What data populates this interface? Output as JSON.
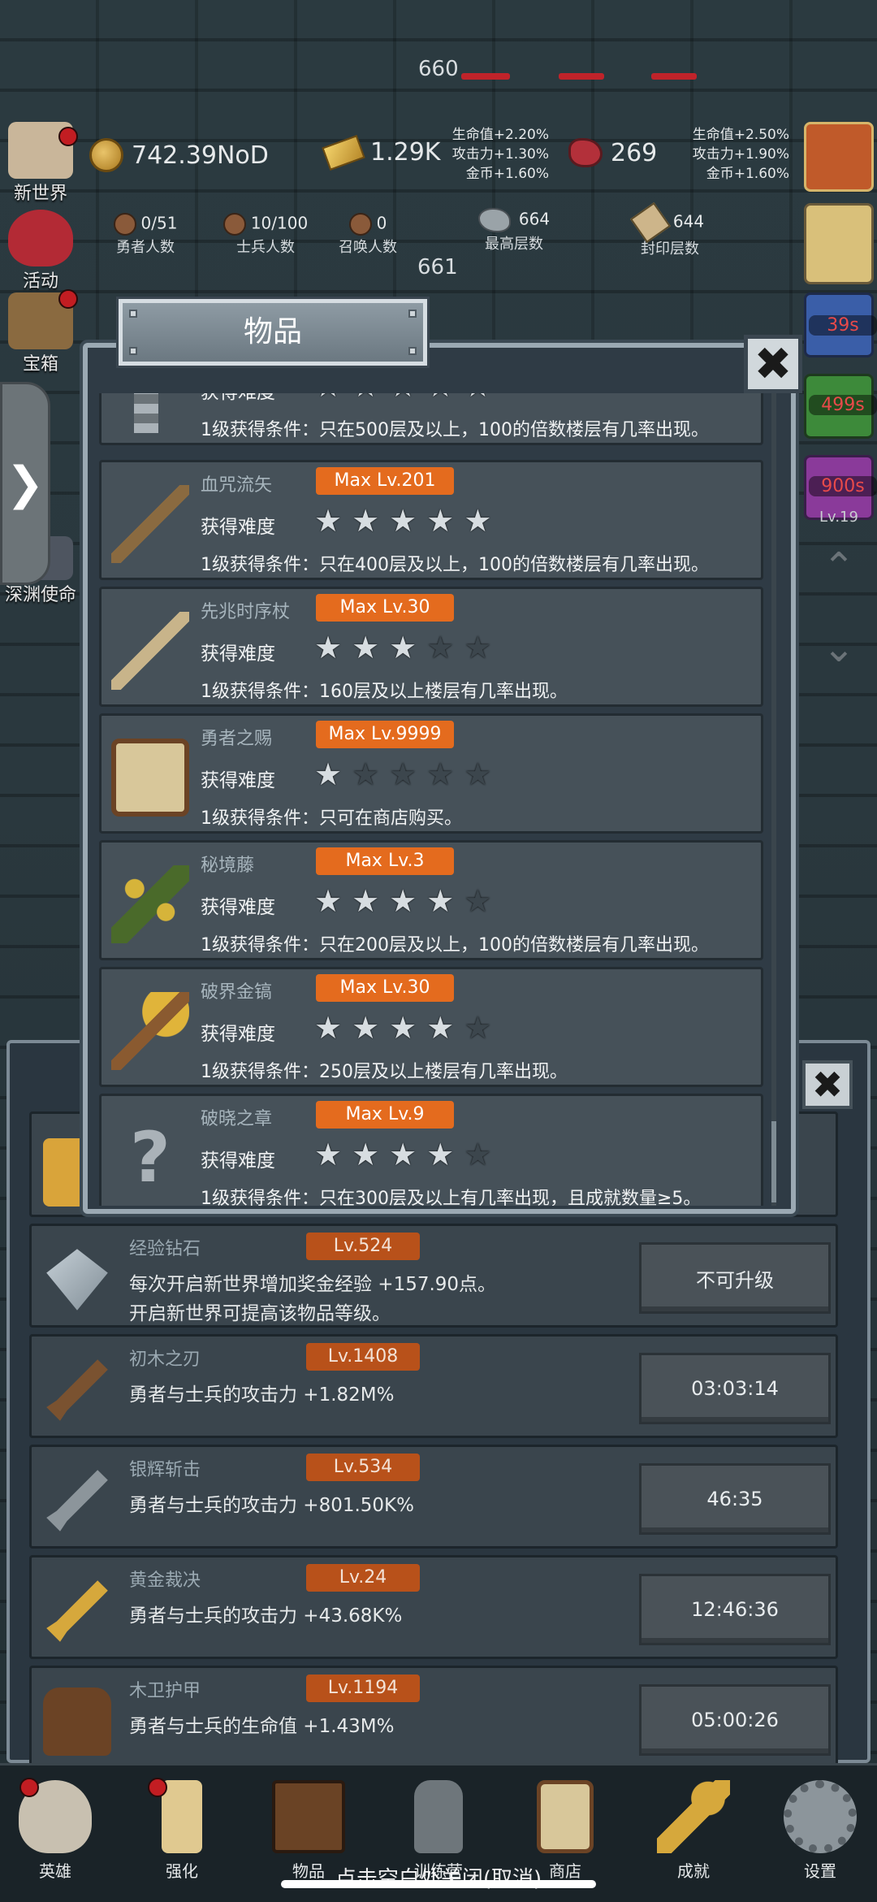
{
  "hud": {
    "boss_hp": "660",
    "currencies": [
      {
        "icon": "coin-icon",
        "value": "742.39NoD"
      },
      {
        "icon": "gold-bar-icon",
        "value": "1.29K"
      },
      {
        "icon": "meat-icon",
        "value": "269"
      }
    ],
    "bonus_left": [
      "生命值+2.20%",
      "攻击力+1.30%",
      "金币+1.60%"
    ],
    "bonus_right": [
      "生命值+2.50%",
      "攻击力+1.90%",
      "金币+1.60%"
    ],
    "counts": [
      {
        "label": "勇者人数",
        "value": "0/51"
      },
      {
        "label": "士兵人数",
        "value": "10/100"
      },
      {
        "label": "召唤人数",
        "value": "0"
      },
      {
        "label": "最高层数",
        "value": "664"
      },
      {
        "label": "封印层数",
        "value": "644"
      }
    ],
    "floor_number": "661"
  },
  "side_left": [
    {
      "label": "新世界",
      "icon": "map-icon"
    },
    {
      "label": "活动",
      "icon": "heart-icon"
    },
    {
      "label": "宝箱",
      "icon": "chest-icon"
    },
    {
      "label": "深渊使命",
      "icon": "abyss-icon"
    }
  ],
  "side_right_timers": [
    "39s",
    "499s",
    "900s"
  ],
  "side_right_level": "Lv.19",
  "modal": {
    "title": "物品",
    "difficulty_label": "获得难度",
    "partial_item": {
      "difficulty": "获得难度",
      "condition": "1级获得条件：只在500层及以上，100的倍数楼层有几率出现。",
      "stars": 5
    },
    "items": [
      {
        "name": "血咒流矢",
        "max": "Max Lv.201",
        "stars": 5,
        "condition": "1级获得条件：只在400层及以上，100的倍数楼层有几率出现。",
        "icon": "arrow-icon"
      },
      {
        "name": "先兆时序杖",
        "max": "Max Lv.30",
        "stars": 3,
        "condition": "1级获得条件：160层及以上楼层有几率出现。",
        "icon": "staff-icon"
      },
      {
        "name": "勇者之赐",
        "max": "Max Lv.9999",
        "stars": 1,
        "condition": "1级获得条件：只可在商店购买。",
        "icon": "beer-mug-icon"
      },
      {
        "name": "秘境藤",
        "max": "Max Lv.3",
        "stars": 4,
        "condition": "1级获得条件：只在200层及以上，100的倍数楼层有几率出现。",
        "icon": "vine-icon"
      },
      {
        "name": "破界金镐",
        "max": "Max Lv.30",
        "stars": 4,
        "condition": "1级获得条件：250层及以上楼层有几率出现。",
        "icon": "pickaxe-icon"
      },
      {
        "name": "破晓之章",
        "max": "Max Lv.9",
        "stars": 4,
        "condition": "1级获得条件：只在300层及以上有几率出现，且成就数量≥5。",
        "icon": "question-mark-icon"
      }
    ]
  },
  "upgrades": [
    {
      "name": "经验钻石",
      "lv": "Lv.524",
      "desc1": "每次开启新世界增加奖金经验 +157.90点。",
      "desc2": "开启新世界可提高该物品等级。",
      "button": "不可升级",
      "icon": "diamond-icon"
    },
    {
      "name": "初木之刃",
      "lv": "Lv.1408",
      "desc1": "勇者与士兵的攻击力 +1.82M%",
      "desc2": "",
      "button": "03:03:14",
      "icon": "wood-sword-icon"
    },
    {
      "name": "银辉斩击",
      "lv": "Lv.534",
      "desc1": "勇者与士兵的攻击力 +801.50K%",
      "desc2": "",
      "button": "46:35",
      "icon": "silver-sword-icon"
    },
    {
      "name": "黄金裁决",
      "lv": "Lv.24",
      "desc1": "勇者与士兵的攻击力 +43.68K%",
      "desc2": "",
      "button": "12:46:36",
      "icon": "gold-sword-icon"
    },
    {
      "name": "木卫护甲",
      "lv": "Lv.1194",
      "desc1": "勇者与士兵的生命值 +1.43M%",
      "desc2": "",
      "button": "05:00:26",
      "icon": "wood-armor-icon"
    }
  ],
  "bottom_nav": [
    {
      "label": "英雄",
      "icon": "skull-icon"
    },
    {
      "label": "强化",
      "icon": "candle-icon"
    },
    {
      "label": "物品",
      "icon": "book-icon"
    },
    {
      "label": "训练营",
      "icon": "lantern-icon"
    },
    {
      "label": "商店",
      "icon": "mug-icon"
    },
    {
      "label": "成就",
      "icon": "key-icon"
    },
    {
      "label": "设置",
      "icon": "gear-icon"
    }
  ],
  "dismiss_hint": "点击空白处关闭(取消)",
  "colors": {
    "accent": "#e46b1e",
    "panel": "#2f3b45",
    "row": "#465159",
    "lv_badge": "#b8511a"
  }
}
